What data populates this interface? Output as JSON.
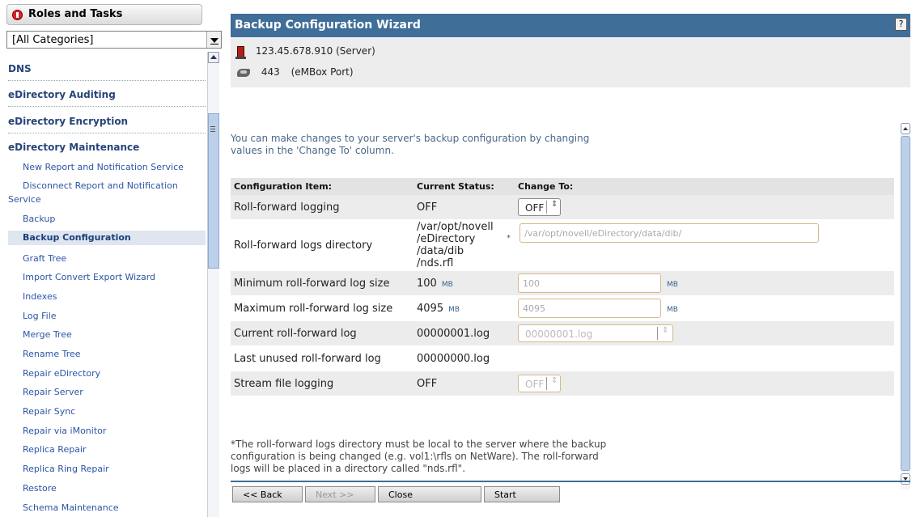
{
  "sidebar": {
    "title": "Roles and Tasks",
    "category_select": "[All Categories]",
    "categories": [
      "DNS",
      "eDirectory Auditing",
      "eDirectory Encryption",
      "eDirectory Maintenance"
    ],
    "tasks": [
      "New Report and Notification Service",
      "Disconnect Report and Notification Service",
      "Backup",
      "Backup Configuration",
      "Graft Tree",
      "Import Convert Export Wizard",
      "Indexes",
      "Log File",
      "Merge Tree",
      "Rename Tree",
      "Repair eDirectory",
      "Repair Server",
      "Repair Sync",
      "Repair via iMonitor",
      "Replica Repair",
      "Replica Ring Repair",
      "Restore",
      "Schema Maintenance"
    ]
  },
  "wizard": {
    "title": "Backup Configuration Wizard",
    "help": "?",
    "server_address": "123.45.678.910",
    "server_label": "(Server)",
    "port": "443",
    "port_label": "(eMBox Port)",
    "intro": "You can make changes to your server's backup configuration by changing values in the 'Change To' column.",
    "columns": [
      "Configuration Item:",
      "Current Status:",
      "Change To:"
    ],
    "rows": {
      "rf_logging": {
        "item": "Roll-forward logging",
        "current": "OFF",
        "change": "OFF"
      },
      "rf_dir": {
        "item": "Roll-forward logs directory",
        "current_lines": [
          "/var/opt/novell",
          "/eDirectory",
          "/data/dib",
          "/nds.rfl"
        ],
        "star": "*",
        "change": "/var/opt/novell/eDirectory/data/dib/"
      },
      "min_size": {
        "item": "Minimum roll-forward log size",
        "current": "100",
        "unit": "MB",
        "change": "100",
        "change_unit": "MB"
      },
      "max_size": {
        "item": "Maximum roll-forward log size",
        "current": "4095",
        "unit": "MB",
        "change": "4095",
        "change_unit": "MB"
      },
      "current_log": {
        "item": "Current roll-forward log",
        "current": "00000001.log",
        "change": "00000001.log"
      },
      "last_unused": {
        "item": "Last unused roll-forward log",
        "current": "00000000.log"
      },
      "stream": {
        "item": "Stream file logging",
        "current": "OFF",
        "change": "OFF"
      }
    },
    "footnote": "*The roll-forward logs directory must be local to the server where the backup configuration is being changed (e.g. vol1:\\rfls on NetWare). The roll-forward logs will be placed in a directory called \"nds.rfl\".",
    "buttons": {
      "back": "<< Back",
      "next": "Next >>",
      "close": "Close",
      "start": "Start"
    }
  },
  "colors": {
    "header_bg": "#3f6e99",
    "link": "#2b55a6",
    "category": "#27457a"
  }
}
